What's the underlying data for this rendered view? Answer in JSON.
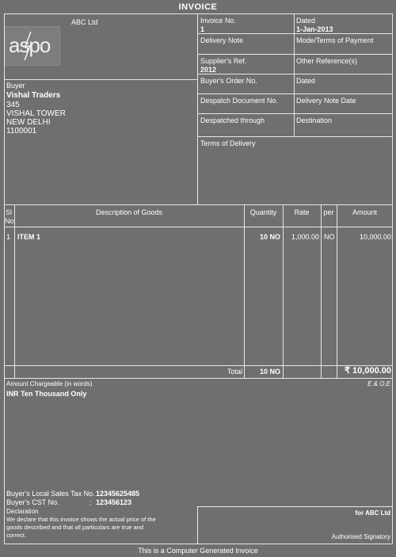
{
  "title": "INVOICE",
  "seller": {
    "name": "ABC Ltd",
    "logo_text": "aspo"
  },
  "header": {
    "invoice_no_label": "Invoice No.",
    "invoice_no": "1",
    "dated_label": "Dated",
    "dated": "1-Jan-2013",
    "delivery_note_label": "Delivery Note",
    "mode_terms_label": "Mode/Terms of Payment",
    "suppliers_ref_label": "Supplier's Ref.",
    "suppliers_ref": "2012",
    "other_refs_label": "Other Reference(s)",
    "buyers_order_label": "Buyer's Order No.",
    "dated2_label": "Dated",
    "despatch_doc_label": "Despatch Document No.",
    "delivery_note_date_label": "Delivery Note Date",
    "despatched_through_label": "Despatched through",
    "destination_label": "Destination",
    "terms_delivery_label": "Terms of Delivery"
  },
  "buyer": {
    "label": "Buyer",
    "name": "Vishal Traders",
    "line1": "345",
    "line2": "VISHAL TOWER",
    "line3": "NEW DELHI",
    "line4": "1100001"
  },
  "table": {
    "headers": {
      "sl": "Sl",
      "no": "No.",
      "desc": "Description of Goods",
      "qty": "Quantity",
      "rate": "Rate",
      "per": "per",
      "amount": "Amount"
    },
    "rows": [
      {
        "sl": "1",
        "desc": "ITEM 1",
        "qty": "10 NO",
        "rate": "1,000.00",
        "per": "NO",
        "amount": "10,000.00"
      }
    ],
    "total_label": "Total",
    "total_qty": "10 NO",
    "total_amount": "₹ 10,000.00"
  },
  "amount_words": {
    "label": "Amount Chargeable (in words)",
    "eoe": "E & O.E",
    "value": "INR Ten Thousand Only"
  },
  "tax": {
    "local_label": "Buyer's Local Sales Tax No. :",
    "local_value": "12345625485",
    "cst_label": "Buyer's CST No.",
    "cst_colon": ":",
    "cst_value": "123456123"
  },
  "declaration": {
    "label": "Declaration",
    "line1": "We declare that this invoice shows the actual price of the",
    "line2": "goods described and that all particulars are true and",
    "line3": "correct."
  },
  "signatory": {
    "for": "for ABC Ltd",
    "label": "Authorised Signatory"
  },
  "footer": "This is a Computer Generated Invoice"
}
